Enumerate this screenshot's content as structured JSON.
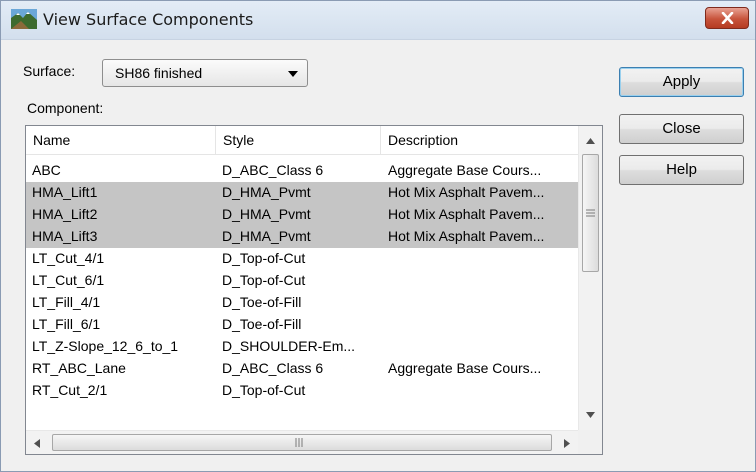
{
  "window": {
    "title": "View Surface Components",
    "close_glyph": "✕"
  },
  "surface": {
    "label": "Surface:",
    "value": "SH86 finished"
  },
  "component_label": "Component:",
  "columns": [
    "Name",
    "Style",
    "Description"
  ],
  "rows": [
    {
      "name": "ABC",
      "style": "D_ABC_Class 6",
      "description": "Aggregate Base Cours...",
      "selected": false
    },
    {
      "name": "HMA_Lift1",
      "style": "D_HMA_Pvmt",
      "description": "Hot Mix Asphalt Pavem...",
      "selected": true
    },
    {
      "name": "HMA_Lift2",
      "style": "D_HMA_Pvmt",
      "description": "Hot Mix Asphalt Pavem...",
      "selected": true
    },
    {
      "name": "HMA_Lift3",
      "style": "D_HMA_Pvmt",
      "description": "Hot Mix Asphalt Pavem...",
      "selected": true
    },
    {
      "name": "LT_Cut_4/1",
      "style": "D_Top-of-Cut",
      "description": "",
      "selected": false
    },
    {
      "name": "LT_Cut_6/1",
      "style": "D_Top-of-Cut",
      "description": "",
      "selected": false
    },
    {
      "name": "LT_Fill_4/1",
      "style": "D_Toe-of-Fill",
      "description": "",
      "selected": false
    },
    {
      "name": "LT_Fill_6/1",
      "style": "D_Toe-of-Fill",
      "description": "",
      "selected": false
    },
    {
      "name": "LT_Z-Slope_12_6_to_1",
      "style": "D_SHOULDER-Em...",
      "description": "",
      "selected": false
    },
    {
      "name": "RT_ABC_Lane",
      "style": "D_ABC_Class 6",
      "description": "Aggregate Base Cours...",
      "selected": false
    },
    {
      "name": "RT_Cut_2/1",
      "style": "D_Top-of-Cut",
      "description": "",
      "selected": false
    }
  ],
  "buttons": {
    "apply": "Apply",
    "close": "Close",
    "help": "Help"
  },
  "icons": {
    "window": "landscape-icon",
    "combo": "chevron-down-icon",
    "scroll_up": "scroll-up-arrow-icon",
    "scroll_down": "scroll-down-arrow-icon",
    "scroll_left": "scroll-left-arrow-icon",
    "scroll_right": "scroll-right-arrow-icon",
    "grip": "scroll-grip-icon"
  },
  "colors": {
    "selected_row": "#c5c5c5",
    "close_button": "#c7533b"
  }
}
